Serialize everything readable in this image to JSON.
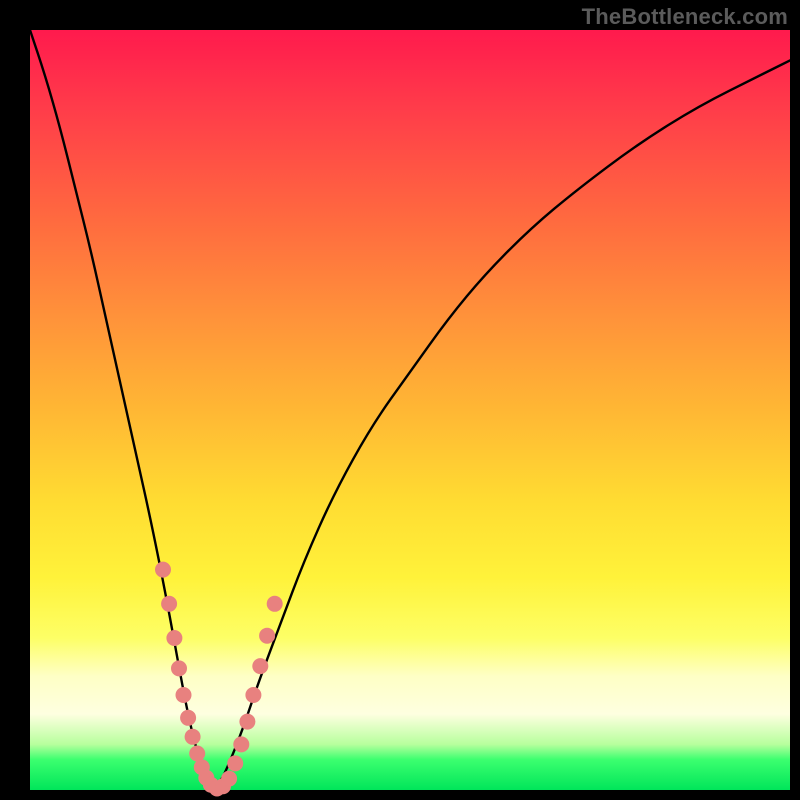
{
  "watermark": "TheBottleneck.com",
  "chart_data": {
    "type": "line",
    "title": "",
    "xlabel": "",
    "ylabel": "",
    "xlim": [
      0,
      100
    ],
    "ylim": [
      0,
      100
    ],
    "grid": false,
    "legend": false,
    "series": [
      {
        "name": "bottleneck-curve",
        "x": [
          0,
          2,
          4,
          6,
          8,
          10,
          12,
          14,
          16,
          18,
          20,
          21,
          22,
          23,
          24,
          25,
          26,
          28,
          30,
          33,
          36,
          40,
          45,
          50,
          55,
          60,
          66,
          72,
          80,
          88,
          96,
          100
        ],
        "values": [
          100,
          94,
          87,
          79,
          71,
          62,
          53,
          44,
          35,
          25,
          14,
          9,
          5,
          2,
          0,
          1,
          3,
          8,
          14,
          22,
          30,
          39,
          48,
          55,
          62,
          68,
          74,
          79,
          85,
          90,
          94,
          96
        ]
      }
    ],
    "markers": {
      "name": "highlighted-points",
      "color": "#e8817f",
      "x": [
        17.5,
        18.3,
        19.0,
        19.6,
        20.2,
        20.8,
        21.4,
        22.0,
        22.6,
        23.2,
        23.8,
        24.6,
        25.4,
        26.2,
        27.0,
        27.8,
        28.6,
        29.4,
        30.3,
        31.2,
        32.2
      ],
      "values": [
        29.0,
        24.5,
        20.0,
        16.0,
        12.5,
        9.5,
        7.0,
        4.8,
        3.0,
        1.6,
        0.7,
        0.2,
        0.5,
        1.5,
        3.5,
        6.0,
        9.0,
        12.5,
        16.3,
        20.3,
        24.5
      ]
    },
    "gradient_bands": [
      {
        "y": 100,
        "color": "#ff1a4d"
      },
      {
        "y": 60,
        "color": "#ff933a"
      },
      {
        "y": 30,
        "color": "#ffe235"
      },
      {
        "y": 12,
        "color": "#feffcf"
      },
      {
        "y": 3,
        "color": "#3cff6f"
      },
      {
        "y": 0,
        "color": "#00e55a"
      }
    ]
  }
}
